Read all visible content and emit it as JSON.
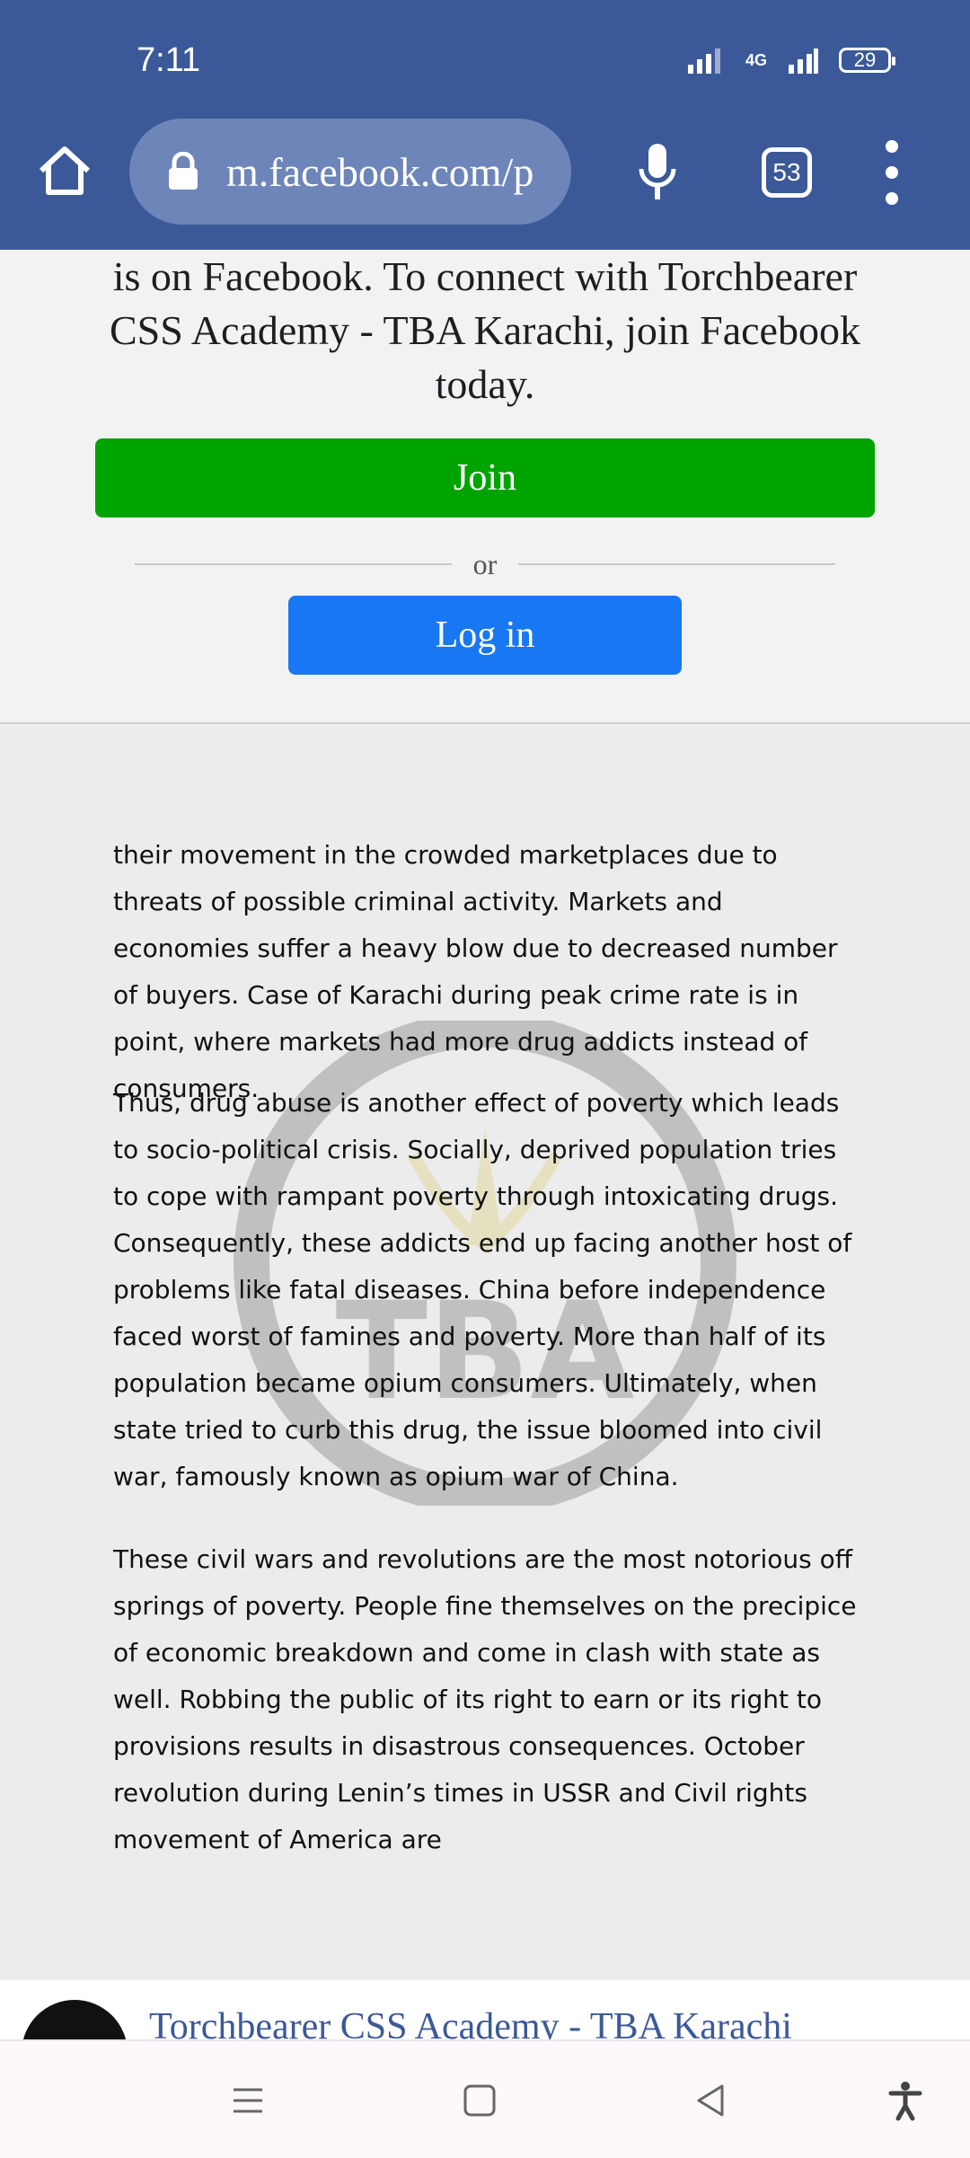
{
  "status": {
    "time": "7:11",
    "network": "4G",
    "battery": "29"
  },
  "browser": {
    "url": "m.facebook.com/p",
    "tab_count": "53"
  },
  "join_prompt": {
    "text": "is on Facebook. To connect with Torchbearer CSS Academy - TBA Karachi, join Facebook today.",
    "join_label": "Join",
    "or_label": "or",
    "login_label": "Log in"
  },
  "article": {
    "paragraphs": [
      "their movement in the crowded marketplaces due to threats of possible criminal activity. Markets and economies suffer a heavy blow due to decreased number of buyers. Case of Karachi during peak crime rate is in point, where markets had more drug addicts instead of consumers.",
      "Thus, drug abuse is another effect of poverty which leads to socio-political crisis. Socially, deprived population tries to cope with rampant poverty through intoxicating drugs. Consequently, these addicts end up facing another host of problems like fatal diseases. China before independence faced worst of famines and poverty. More than half of its population became opium consumers. Ultimately, when state tried to curb this drug, the issue bloomed into civil war, famously known as opium war of China.",
      "These civil wars and revolutions are the most notorious off springs of poverty. People fine themselves on the precipice of economic breakdown and come in clash with state as well. Robbing the public of its right to earn or its right to provisions results in disastrous consequences. October revolution during Lenin’s times in USSR and Civil rights movement of America are"
    ],
    "watermark_text": "TBA"
  },
  "page_card": {
    "title": "Torchbearer CSS Academy - TBA Karachi"
  },
  "colors": {
    "facebook_blue": "#3b5998",
    "join_green": "#00a400",
    "login_blue": "#1877f2"
  }
}
